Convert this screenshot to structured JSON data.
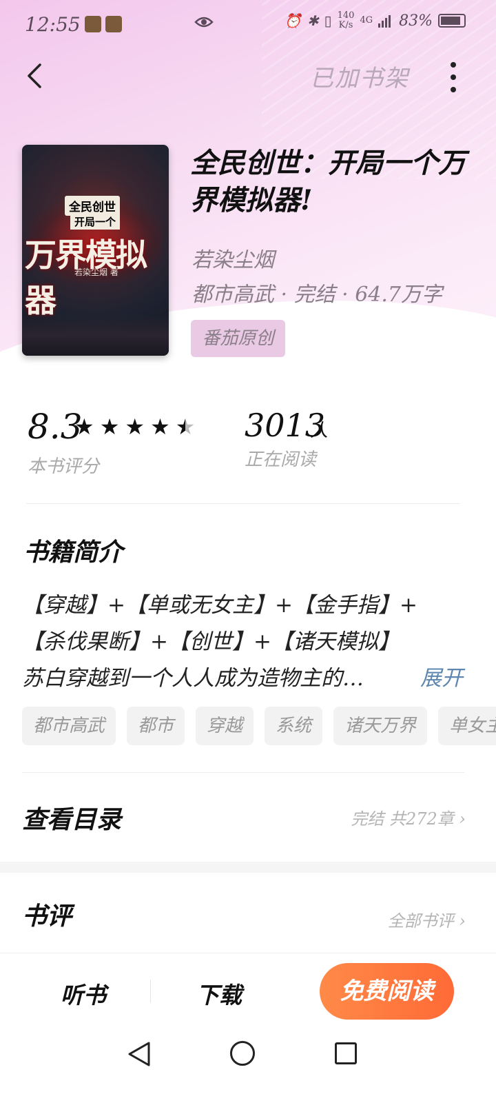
{
  "status_bar": {
    "time": "12:55",
    "net_speed_value": "140",
    "net_speed_unit": "K/s",
    "signal": "4G",
    "battery": "83%"
  },
  "header": {
    "shelf_label": "已加书架"
  },
  "book": {
    "title": "全民创世：开局一个万界模拟器!",
    "author": "若染尘烟",
    "meta": "都市高武 · 完结 · 64.7万字",
    "badge": "番茄原创",
    "cover": {
      "line1": "全民创世",
      "line2": "开局一个",
      "line3": "万界模拟器",
      "author_line": "若染尘烟 著"
    }
  },
  "stats": {
    "score": "8.3",
    "score_label": "本书评分",
    "stars_value": 4.5,
    "stars_max": 5,
    "readers": "3013",
    "readers_unit": "人",
    "readers_label": "正在阅读"
  },
  "intro": {
    "title": "书籍简介",
    "lines": [
      "【穿越】+【单或无女主】+【金手指】+",
      "【杀伐果断】+【创世】+【诸天模拟】",
      "苏白穿越到一个人人成为造物主的…"
    ],
    "expand_label": "展开"
  },
  "tags": [
    "都市高武",
    "都市",
    "穿越",
    "系统",
    "诸天万界",
    "单女主"
  ],
  "toc": {
    "title": "查看目录",
    "info": "完结 共272章"
  },
  "reviews": {
    "title": "书评",
    "link": "全部书评"
  },
  "bottom_bar": {
    "listen": "听书",
    "download": "下载",
    "read": "免费阅读"
  },
  "colors": {
    "hero_pink": "#f3c7ec",
    "accent_orange": "#ff7a3d",
    "link_blue": "#5d86b0"
  }
}
